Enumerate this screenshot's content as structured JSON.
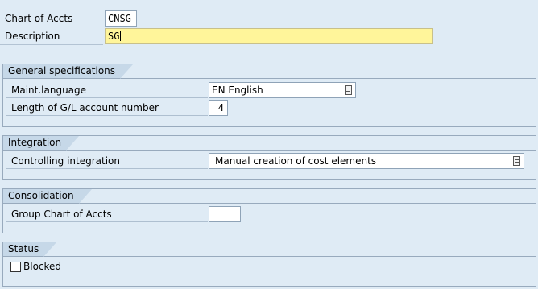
{
  "header": {
    "chart_label": "Chart of Accts",
    "chart_value": "CNSG",
    "description_label": "Description",
    "description_value": "SG"
  },
  "groups": {
    "general": {
      "title": "General specifications",
      "maint_language_label": "Maint.language",
      "maint_language_value": "EN English",
      "gl_length_label": "Length of G/L account number",
      "gl_length_value": "4"
    },
    "integration": {
      "title": "Integration",
      "controlling_label": "Controlling integration",
      "controlling_value": "Manual creation of cost elements"
    },
    "consolidation": {
      "title": "Consolidation",
      "group_chart_label": "Group Chart of Accts",
      "group_chart_value": ""
    },
    "status": {
      "title": "Status",
      "blocked_label": "Blocked",
      "blocked_checked": false
    }
  },
  "icons": {
    "value_help": "value-help-icon"
  },
  "colors": {
    "background": "#dfebf5",
    "required_field": "#fff59a",
    "group_title": "#c6d8e8"
  }
}
